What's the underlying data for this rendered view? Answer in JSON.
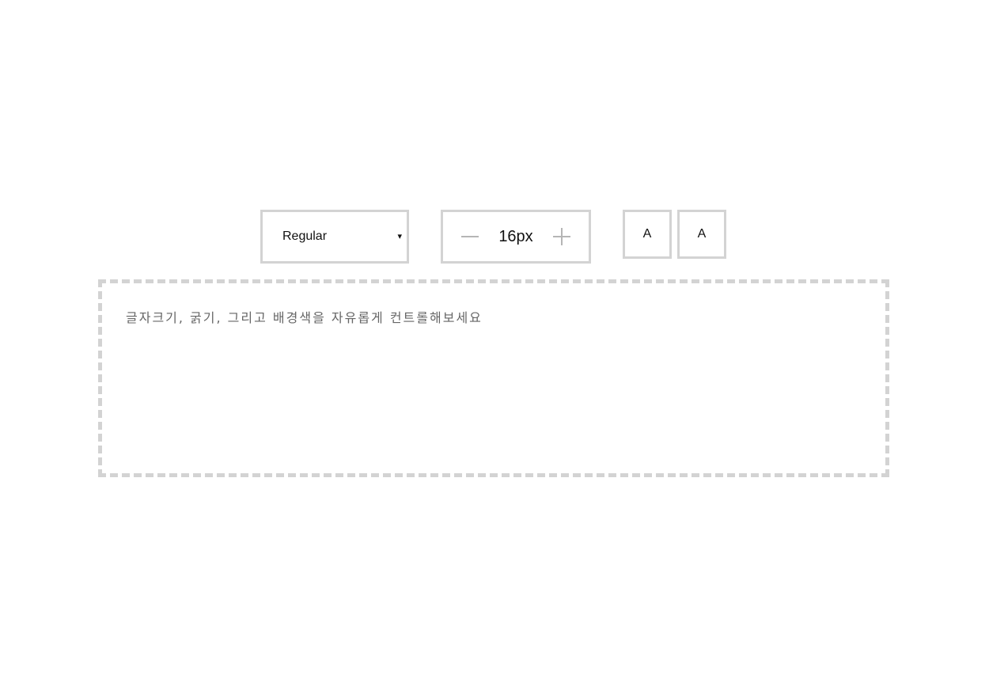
{
  "toolbar": {
    "font_weight": {
      "selected": "Regular",
      "caret": "▾"
    },
    "font_size": {
      "value": "16px"
    },
    "color_buttons": {
      "first_label": "A",
      "second_label": "A"
    }
  },
  "editor": {
    "text": "글자크기, 굵기, 그리고 배경색을 자유롭게 컨트롤해보세요"
  },
  "colors": {
    "border": "#d3d3d3",
    "text": "#111111",
    "muted_text": "#666666",
    "icon": "#b5b5b5"
  }
}
